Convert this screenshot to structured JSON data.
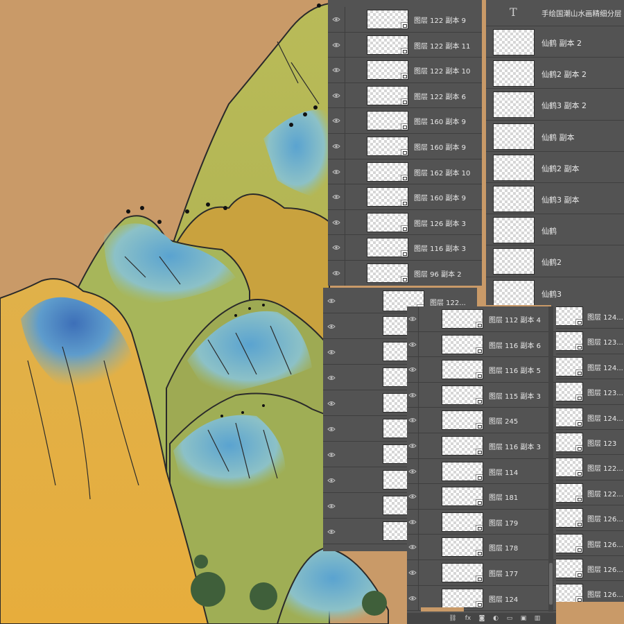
{
  "panel_a": {
    "layers": [
      {
        "name": "图层 122 副本 9"
      },
      {
        "name": "图层 122 副本 11"
      },
      {
        "name": "图层 122 副本 10"
      },
      {
        "name": "图层 122 副本 6"
      },
      {
        "name": "图层 160 副本 9"
      },
      {
        "name": "图层 160 副本 9"
      },
      {
        "name": "图层 162 副本 10"
      },
      {
        "name": "图层 160 副本 9"
      },
      {
        "name": "图层 126 副本 3"
      },
      {
        "name": "图层 116 副本 3"
      },
      {
        "name": "图层 96 副本 2"
      }
    ]
  },
  "panel_b": {
    "text_layer": {
      "icon": "text-tool-icon",
      "glyph": "T",
      "name": "手绘国潮山水画精细分层"
    },
    "layers": [
      {
        "name": "仙鹤 副本 2"
      },
      {
        "name": "仙鹤2 副本 2"
      },
      {
        "name": "仙鹤3 副本 2"
      },
      {
        "name": "仙鹤 副本"
      },
      {
        "name": "仙鹤2 副本"
      },
      {
        "name": "仙鹤3 副本"
      },
      {
        "name": "仙鹤"
      },
      {
        "name": "仙鹤2"
      },
      {
        "name": "仙鹤3"
      }
    ]
  },
  "panel_c": {
    "top_label": "图层 122..."
  },
  "panel_d": {
    "layers": [
      {
        "name": "图层 112 副本 4"
      },
      {
        "name": "图层 116 副本 6"
      },
      {
        "name": "图层 116 副本 5"
      },
      {
        "name": "图层 115 副本 3"
      },
      {
        "name": "图层 245"
      },
      {
        "name": "图层 116 副本 3"
      },
      {
        "name": "图层 114"
      },
      {
        "name": "图层 181"
      },
      {
        "name": "图层 179"
      },
      {
        "name": "图层 178"
      },
      {
        "name": "图层 177"
      },
      {
        "name": "图层 124"
      }
    ],
    "footer_icons": [
      "link-icon",
      "fx-icon",
      "mask-icon",
      "adjustment-icon",
      "folder-icon",
      "new-layer-icon",
      "trash-icon"
    ],
    "footer_fx_label": "fx"
  },
  "panel_e": {
    "layers": [
      {
        "name": "图层 124..."
      },
      {
        "name": "图层 123..."
      },
      {
        "name": "图层 124..."
      },
      {
        "name": "图层 123..."
      },
      {
        "name": "图层 124..."
      },
      {
        "name": "图层 123"
      },
      {
        "name": "图层 122..."
      },
      {
        "name": "图层 122..."
      },
      {
        "name": "图层 126..."
      },
      {
        "name": "图层 126..."
      },
      {
        "name": "图层 126..."
      },
      {
        "name": "图层 126..."
      }
    ]
  },
  "colors": {
    "sky": "#c99a68",
    "panel_bg": "#535353",
    "row_divider": "#3e3e3e",
    "text": "#eaeaea"
  }
}
